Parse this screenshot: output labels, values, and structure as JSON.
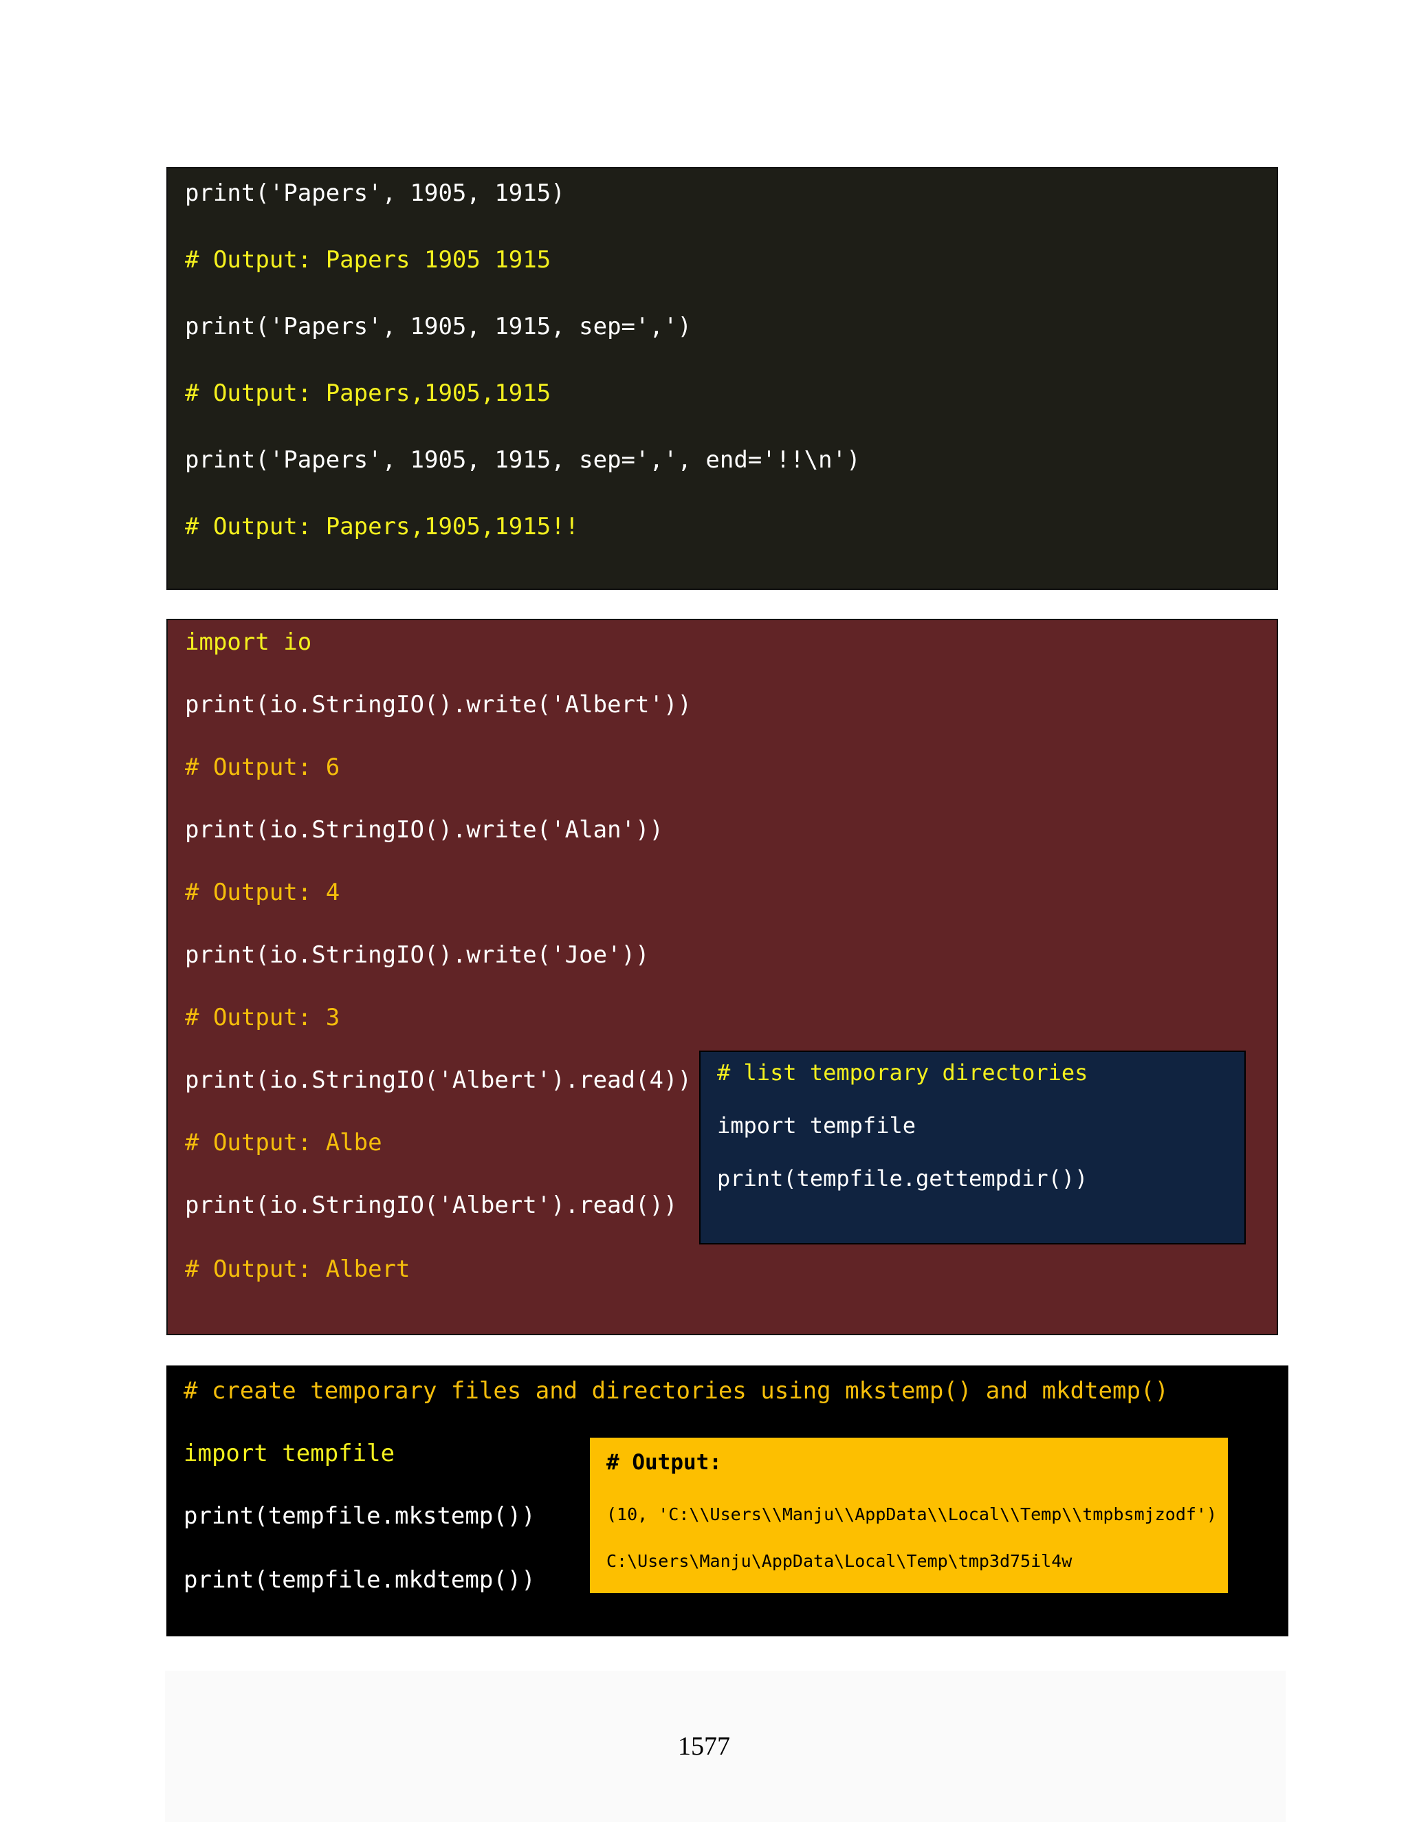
{
  "block1": {
    "lines": [
      "print('Papers', 1905, 1915)",
      "# Output: Papers 1905 1915",
      "print('Papers', 1905, 1915, sep=',')",
      "# Output: Papers,1905,1915",
      "print('Papers', 1905, 1915, sep=',', end='!!\\n')",
      "# Output: Papers,1905,1915!!"
    ]
  },
  "block2": {
    "lines": [
      "import io",
      "print(io.StringIO().write('Albert'))",
      "# Output: 6",
      "print(io.StringIO().write('Alan'))",
      "# Output: 4",
      "print(io.StringIO().write('Joe'))",
      "# Output: 3",
      "print(io.StringIO('Albert').read(4))",
      "# Output: Albe",
      "print(io.StringIO('Albert').read())",
      "# Output: Albert"
    ],
    "inset": {
      "lines": [
        "# list temporary directories",
        "import tempfile",
        "print(tempfile.gettempdir())"
      ]
    }
  },
  "block3": {
    "lines": [
      "# create temporary files and directories using mkstemp() and mkdtemp()",
      "import tempfile",
      "print(tempfile.mkstemp())",
      "print(tempfile.mkdtemp())"
    ],
    "output": {
      "title": "# Output:",
      "lines": [
        "(10, 'C:\\\\Users\\\\Manju\\\\AppData\\\\Local\\\\Temp\\\\tmpbsmjzodf')",
        "C:\\Users\\Manju\\AppData\\Local\\Temp\\tmp3d75il4w"
      ]
    }
  },
  "page_number": "1577"
}
